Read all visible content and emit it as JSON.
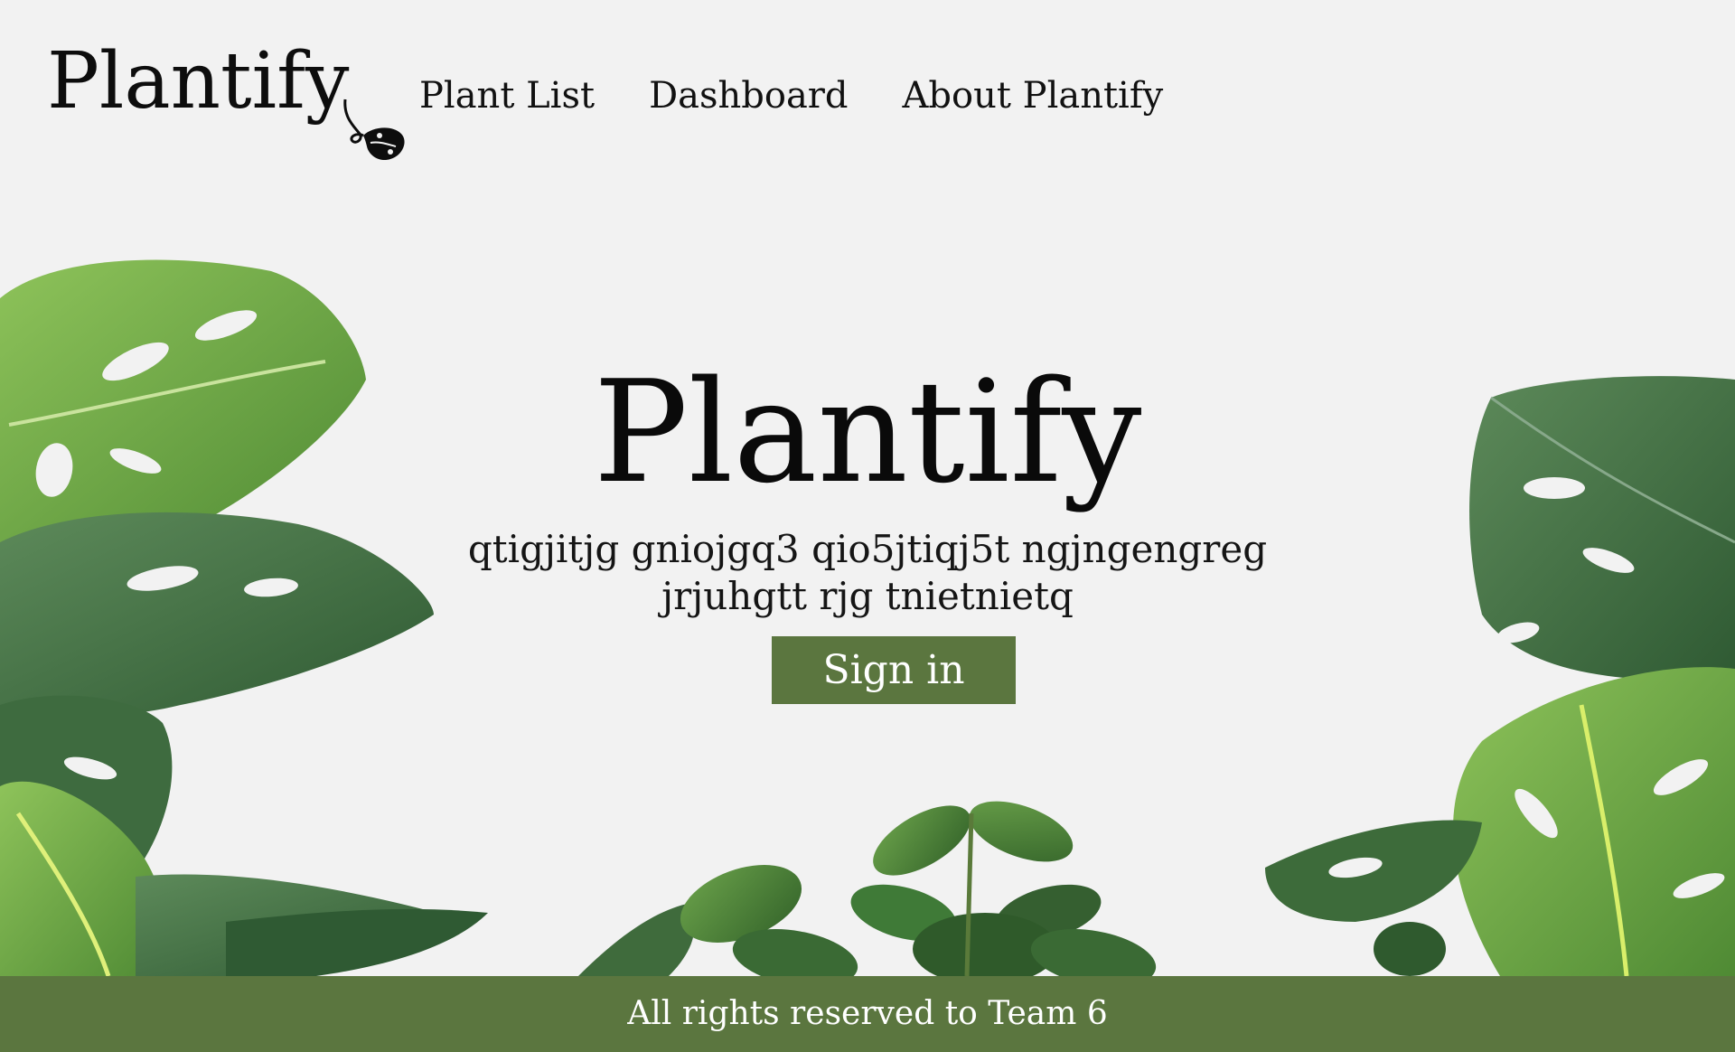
{
  "header": {
    "logo_text": "Plantify",
    "nav": [
      {
        "label": "Plant List"
      },
      {
        "label": "Dashboard"
      },
      {
        "label": "About Plantify"
      }
    ]
  },
  "hero": {
    "title": "Plantify",
    "subtitle_line1": "qtigjitjg gniojgq3 qio5jtiqj5t ngjngengreg",
    "subtitle_line2": "jrjuhgtt rjg tnietnietq",
    "signin_label": "Sign in"
  },
  "footer": {
    "text": "All rights reserved to Team 6"
  },
  "colors": {
    "background": "#f2f2f2",
    "accent": "#5b763f",
    "text": "#111111",
    "leaf_light": "#7fb34a",
    "leaf_dark": "#3f6b3c"
  },
  "icons": {
    "logo_flourish": "vine-leaf-icon",
    "decoration": "monstera-leaf-decoration"
  }
}
